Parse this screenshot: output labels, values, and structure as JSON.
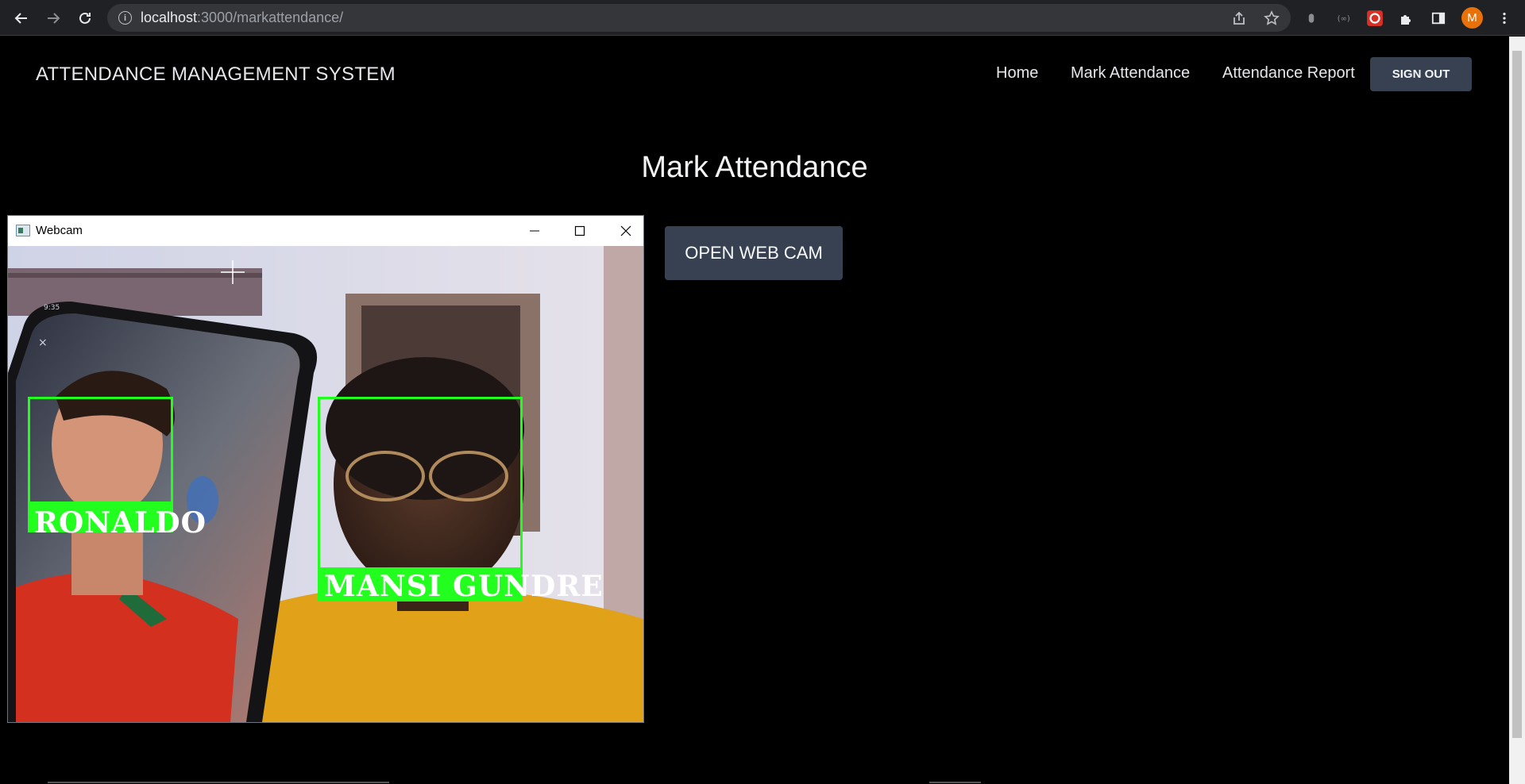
{
  "browser": {
    "url_host": "localhost",
    "url_rest": ":3000/markattendance/",
    "avatar_letter": "M",
    "icons": [
      "back-arrow-icon",
      "forward-arrow-icon",
      "reload-icon",
      "info-icon",
      "share-icon",
      "star-icon",
      "extension-icon",
      "puzzle-icon",
      "sidebar-icon",
      "menu-icon"
    ]
  },
  "navbar": {
    "brand": "ATTENDANCE MANAGEMENT SYSTEM",
    "links": [
      "Home",
      "Mark Attendance",
      "Attendance Report"
    ],
    "signout": "SIGN OUT"
  },
  "main": {
    "title": "Mark Attendance",
    "open_cam_label": "OPEN WEB CAM"
  },
  "webcam": {
    "window_title": "Webcam",
    "faces": [
      {
        "name": "RONALDO"
      },
      {
        "name": "MANSI GUNDRE"
      }
    ]
  },
  "colors": {
    "page_bg": "#000000",
    "button_bg": "#374151",
    "face_box": "#22ff1e",
    "browser_bg": "#202124"
  }
}
